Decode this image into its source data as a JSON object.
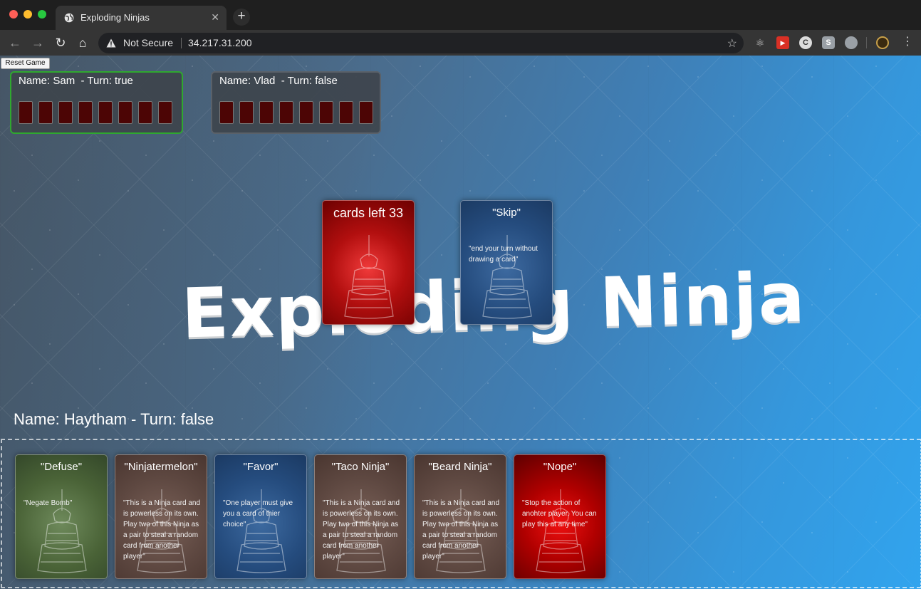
{
  "browser": {
    "tab_title": "Exploding Ninjas",
    "tab_close": "✕",
    "new_tab": "+",
    "security_label": "Not Secure",
    "url": "34.217.31.200"
  },
  "page": {
    "reset_button": "Reset Game",
    "logo_text": "Exploding Ninja",
    "opponents": [
      {
        "label": "Name: Sam  - Turn: true",
        "cards": 8,
        "active": true
      },
      {
        "label": "Name: Vlad  - Turn: false",
        "cards": 8,
        "active": false
      }
    ],
    "deck": {
      "label": "cards left 33"
    },
    "discard": {
      "title": "\"Skip\"",
      "description": "\"end your turn without drawing a card\""
    },
    "current_player": "Name: Haytham - Turn: false",
    "hand": [
      {
        "title": "\"Defuse\"",
        "description": "\"Negate Bomb\""
      },
      {
        "title": "\"Ninjatermelon\"",
        "description": "\"This is a Ninja card and is powerless on its own. Play two of this Ninja as a pair to steal a random card from another player\""
      },
      {
        "title": "\"Favor\"",
        "description": "\"One player must give you a card of thier choice\""
      },
      {
        "title": "\"Taco Ninja\"",
        "description": "\"This is a Ninja card and is powerless on its own. Play two of this Ninja as a pair to steal a random card from another player\""
      },
      {
        "title": "\"Beard Ninja\"",
        "description": "\"This is a Ninja card and is powerless on its own. Play two of this Ninja as a pair to steal a random card from another player\""
      },
      {
        "title": "\"Nope\"",
        "description": "\"Stop the action of anohter player. You can play this at any time\""
      }
    ]
  },
  "colors": {
    "active_border": "#2fa82f",
    "card_back": "#4c0505"
  }
}
